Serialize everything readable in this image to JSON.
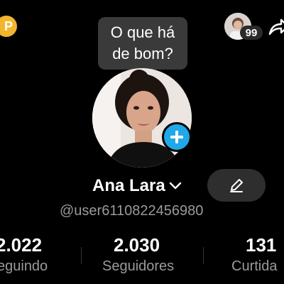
{
  "header": {
    "points_icon_glyph": "P",
    "notification_count": "99"
  },
  "composer_prompt": {
    "line1": "O que há",
    "line2": "de bom?"
  },
  "profile": {
    "display_name": "Ana Lara",
    "handle": "@user6110822456980"
  },
  "stats": [
    {
      "value": "2.022",
      "label": "eguindo"
    },
    {
      "value": "2.030",
      "label": "Seguidores"
    },
    {
      "value": "131",
      "label": "Curtida"
    }
  ],
  "colors": {
    "background": "#000000",
    "accent_blue": "#20a8e8",
    "coin_gold": "#f2b52d",
    "muted_text": "#9a9a9a"
  }
}
